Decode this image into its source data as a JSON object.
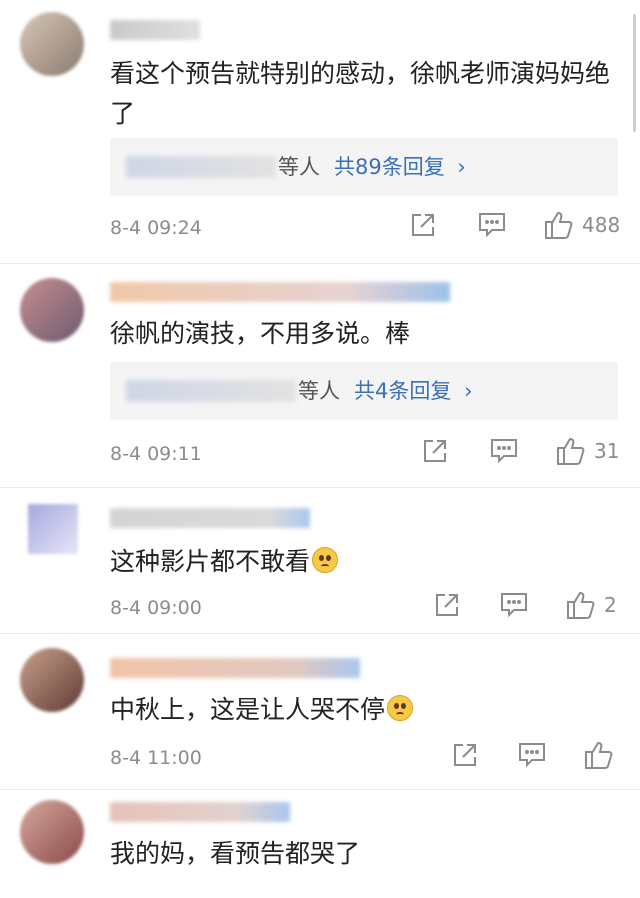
{
  "comments": [
    {
      "avatar_colors": [
        "#d8c7b7",
        "#8a7b6f"
      ],
      "name_colors": [
        "#c9c9c9",
        "#e0e0e0"
      ],
      "text": "看这个预告就特别的感动，徐帆老师演妈妈绝了",
      "reply_visible": "等人",
      "reply_link": "共89条回复",
      "time": "8-4 09:24",
      "like_count": "488",
      "icons": [
        "share-icon",
        "comment-icon",
        "like-icon"
      ]
    },
    {
      "avatar_colors": [
        "#c98f8f",
        "#6b5a70"
      ],
      "name_colors": [
        "#f0c8a8",
        "#9ec0ea"
      ],
      "text": "徐帆的演技，不用多说。棒",
      "reply_visible": "等人",
      "reply_link": "共4条回复",
      "time": "8-4 09:11",
      "like_count": "31",
      "icons": [
        "share-icon",
        "comment-icon",
        "like-icon"
      ]
    },
    {
      "avatar_colors": [
        "#a7a7df",
        "#e6e6f7"
      ],
      "name_colors": [
        "#d4d4d4",
        "#a9c7ee"
      ],
      "text": "这种影片都不敢看",
      "emoji": "crying-face-emoji",
      "time": "8-4 09:00",
      "like_count": "2",
      "icons": [
        "share-icon",
        "comment-icon",
        "like-icon"
      ]
    },
    {
      "avatar_colors": [
        "#caa08a",
        "#5d3b35"
      ],
      "name_colors": [
        "#f2c4a8",
        "#a9c7ee"
      ],
      "text": "中秋上，这是让人哭不停",
      "emoji": "crying-face-emoji",
      "time": "8-4 11:00",
      "like_count": "",
      "icons": [
        "share-icon",
        "comment-icon",
        "like-icon"
      ]
    },
    {
      "avatar_colors": [
        "#d6a89c",
        "#8b4a4a"
      ],
      "name_colors": [
        "#e6c2b8",
        "#a9c7ee"
      ],
      "text": "我的妈，看预告都哭了"
    }
  ],
  "colors": {
    "link": "#3b6fb6",
    "meta": "#8c8c8c",
    "reply_bg": "#f4f4f4"
  }
}
